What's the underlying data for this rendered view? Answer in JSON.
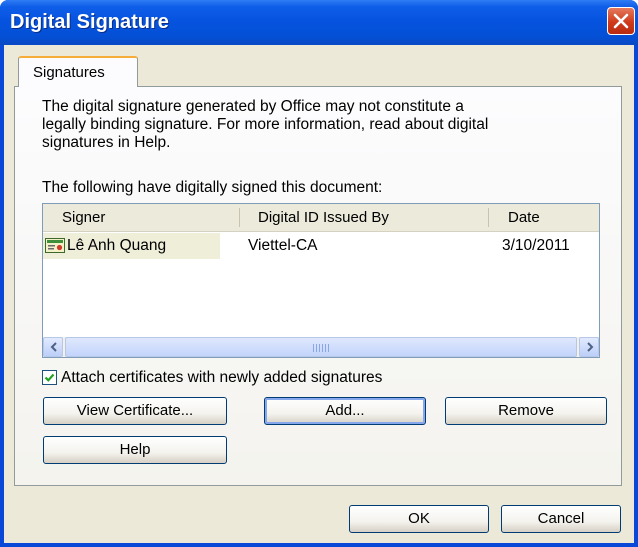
{
  "window": {
    "title": "Digital Signature"
  },
  "tabs": [
    {
      "label": "Signatures"
    }
  ],
  "intro_text": {
    "line1": "The digital signature generated by Office may not constitute a",
    "line2": "legally binding signature. For more information, read about digital",
    "line3": "signatures in Help."
  },
  "list_caption": "The following have digitally signed this document:",
  "signers_table": {
    "columns": [
      "Signer",
      "Digital ID Issued By",
      "Date"
    ],
    "rows": [
      {
        "signer": "Lê Anh Quang",
        "issued_by": "Viettel-CA",
        "date": "3/10/2011"
      }
    ]
  },
  "attach_certificates": {
    "label": "Attach certificates with newly added signatures",
    "checked": true
  },
  "buttons": {
    "view_certificate": "View Certificate...",
    "add": "Add...",
    "remove": "Remove",
    "help": "Help",
    "ok": "OK",
    "cancel": "Cancel"
  },
  "colors": {
    "titlebar": "#0653e0",
    "dialog_face": "#ece9d8",
    "close_button": "#cf3b1a",
    "tab_highlight": "#f7ad3a"
  }
}
